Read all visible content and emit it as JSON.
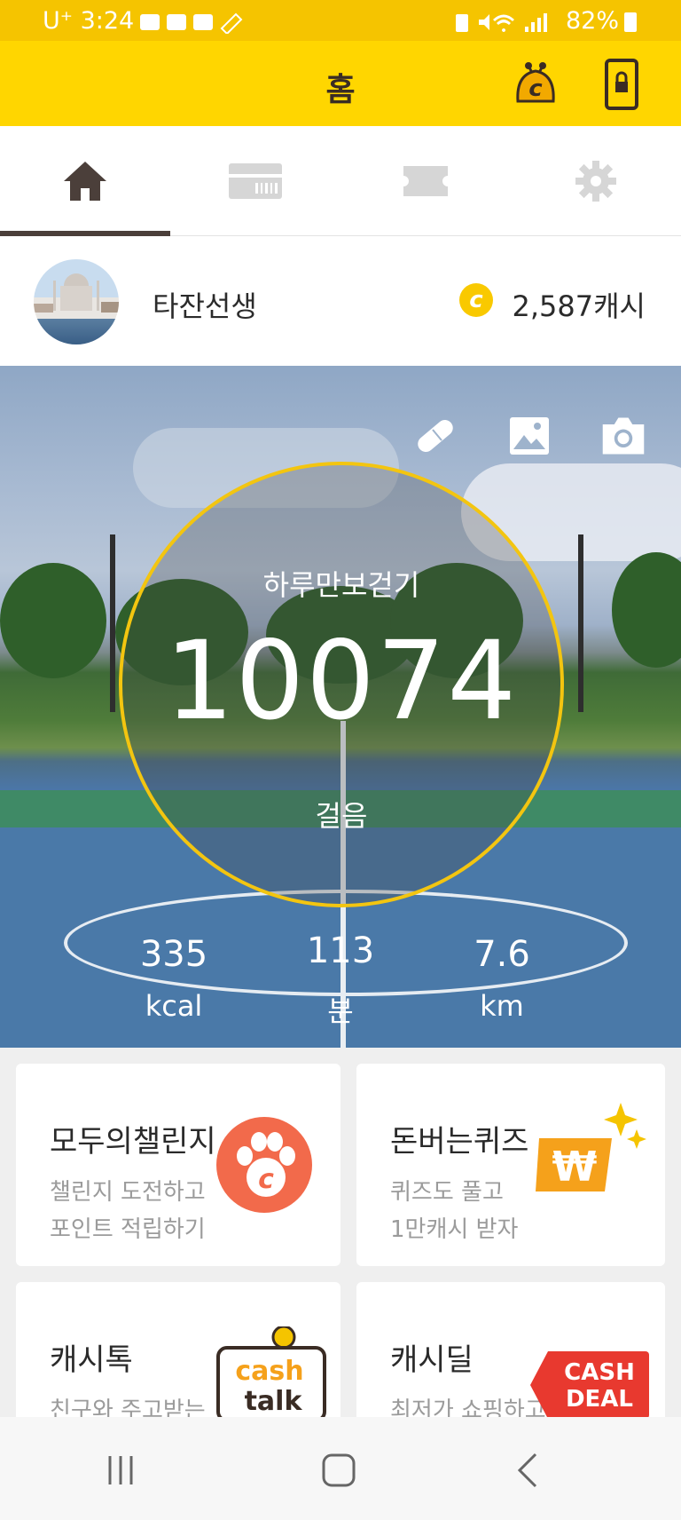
{
  "status_bar": {
    "time": "U⁺ 3:24",
    "battery": "82%"
  },
  "header": {
    "title": "홈"
  },
  "tabs": [
    {
      "name": "home-icon",
      "active": true
    },
    {
      "name": "gift-card-icon",
      "active": false
    },
    {
      "name": "ticket-icon",
      "active": false
    },
    {
      "name": "gear-icon",
      "active": false
    }
  ],
  "profile": {
    "username": "타잔선생",
    "coin_symbol": "c",
    "cash": "2,587캐시"
  },
  "hero": {
    "goal_label": "하루만보걷기",
    "steps": "10074",
    "steps_unit": "걸음",
    "stats": [
      {
        "value": "335",
        "unit": "kcal"
      },
      {
        "value": "113",
        "unit": "분"
      },
      {
        "value": "7.6",
        "unit": "km"
      }
    ],
    "icons": [
      "pill-icon",
      "image-icon",
      "camera-icon"
    ]
  },
  "cards": [
    {
      "title": "모두의챌린지",
      "line1": "챌린지 도전하고",
      "line2": "포인트 적립하기",
      "icon": "paw-coin-icon"
    },
    {
      "title": "돈버는퀴즈",
      "line1": "퀴즈도 풀고",
      "line2": "1만캐시 받자",
      "icon": "won-sparkle-icon"
    },
    {
      "title": "캐시톡",
      "line1": "친구와 주고받는",
      "icon": "cash-talk-logo",
      "logo_text": [
        "cash",
        "talk"
      ]
    },
    {
      "title": "캐시딜",
      "line1": "최저가 쇼핑하고",
      "icon": "cash-deal-logo",
      "logo_text": [
        "CASH",
        "DEAL"
      ]
    }
  ],
  "colors": {
    "brand_yellow": "#ffd600",
    "status_yellow": "#f5c400",
    "ring": "#f3c510",
    "paw_orange": "#f26a4b",
    "deal_red": "#e8392f"
  }
}
